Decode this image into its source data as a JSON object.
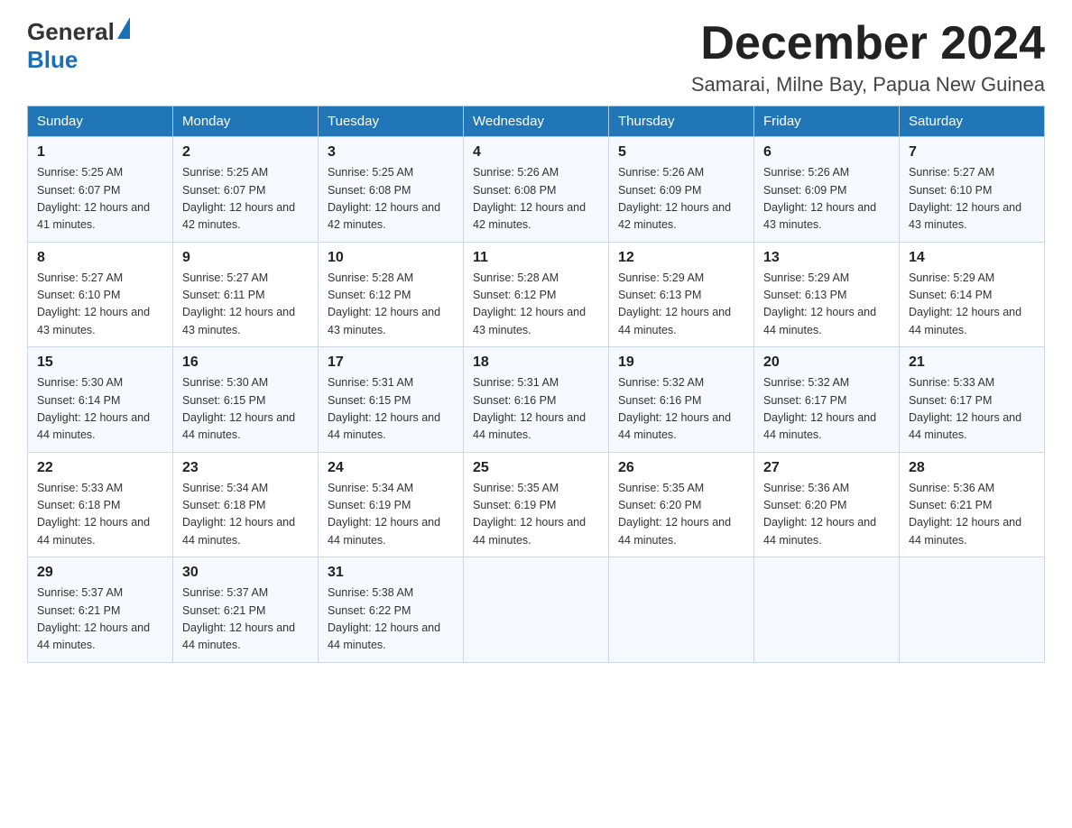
{
  "header": {
    "logo_general": "General",
    "logo_blue": "Blue",
    "month_title": "December 2024",
    "location": "Samarai, Milne Bay, Papua New Guinea"
  },
  "weekdays": [
    "Sunday",
    "Monday",
    "Tuesday",
    "Wednesday",
    "Thursday",
    "Friday",
    "Saturday"
  ],
  "weeks": [
    [
      {
        "day": "1",
        "sunrise": "5:25 AM",
        "sunset": "6:07 PM",
        "daylight": "12 hours and 41 minutes."
      },
      {
        "day": "2",
        "sunrise": "5:25 AM",
        "sunset": "6:07 PM",
        "daylight": "12 hours and 42 minutes."
      },
      {
        "day": "3",
        "sunrise": "5:25 AM",
        "sunset": "6:08 PM",
        "daylight": "12 hours and 42 minutes."
      },
      {
        "day": "4",
        "sunrise": "5:26 AM",
        "sunset": "6:08 PM",
        "daylight": "12 hours and 42 minutes."
      },
      {
        "day": "5",
        "sunrise": "5:26 AM",
        "sunset": "6:09 PM",
        "daylight": "12 hours and 42 minutes."
      },
      {
        "day": "6",
        "sunrise": "5:26 AM",
        "sunset": "6:09 PM",
        "daylight": "12 hours and 43 minutes."
      },
      {
        "day": "7",
        "sunrise": "5:27 AM",
        "sunset": "6:10 PM",
        "daylight": "12 hours and 43 minutes."
      }
    ],
    [
      {
        "day": "8",
        "sunrise": "5:27 AM",
        "sunset": "6:10 PM",
        "daylight": "12 hours and 43 minutes."
      },
      {
        "day": "9",
        "sunrise": "5:27 AM",
        "sunset": "6:11 PM",
        "daylight": "12 hours and 43 minutes."
      },
      {
        "day": "10",
        "sunrise": "5:28 AM",
        "sunset": "6:12 PM",
        "daylight": "12 hours and 43 minutes."
      },
      {
        "day": "11",
        "sunrise": "5:28 AM",
        "sunset": "6:12 PM",
        "daylight": "12 hours and 43 minutes."
      },
      {
        "day": "12",
        "sunrise": "5:29 AM",
        "sunset": "6:13 PM",
        "daylight": "12 hours and 44 minutes."
      },
      {
        "day": "13",
        "sunrise": "5:29 AM",
        "sunset": "6:13 PM",
        "daylight": "12 hours and 44 minutes."
      },
      {
        "day": "14",
        "sunrise": "5:29 AM",
        "sunset": "6:14 PM",
        "daylight": "12 hours and 44 minutes."
      }
    ],
    [
      {
        "day": "15",
        "sunrise": "5:30 AM",
        "sunset": "6:14 PM",
        "daylight": "12 hours and 44 minutes."
      },
      {
        "day": "16",
        "sunrise": "5:30 AM",
        "sunset": "6:15 PM",
        "daylight": "12 hours and 44 minutes."
      },
      {
        "day": "17",
        "sunrise": "5:31 AM",
        "sunset": "6:15 PM",
        "daylight": "12 hours and 44 minutes."
      },
      {
        "day": "18",
        "sunrise": "5:31 AM",
        "sunset": "6:16 PM",
        "daylight": "12 hours and 44 minutes."
      },
      {
        "day": "19",
        "sunrise": "5:32 AM",
        "sunset": "6:16 PM",
        "daylight": "12 hours and 44 minutes."
      },
      {
        "day": "20",
        "sunrise": "5:32 AM",
        "sunset": "6:17 PM",
        "daylight": "12 hours and 44 minutes."
      },
      {
        "day": "21",
        "sunrise": "5:33 AM",
        "sunset": "6:17 PM",
        "daylight": "12 hours and 44 minutes."
      }
    ],
    [
      {
        "day": "22",
        "sunrise": "5:33 AM",
        "sunset": "6:18 PM",
        "daylight": "12 hours and 44 minutes."
      },
      {
        "day": "23",
        "sunrise": "5:34 AM",
        "sunset": "6:18 PM",
        "daylight": "12 hours and 44 minutes."
      },
      {
        "day": "24",
        "sunrise": "5:34 AM",
        "sunset": "6:19 PM",
        "daylight": "12 hours and 44 minutes."
      },
      {
        "day": "25",
        "sunrise": "5:35 AM",
        "sunset": "6:19 PM",
        "daylight": "12 hours and 44 minutes."
      },
      {
        "day": "26",
        "sunrise": "5:35 AM",
        "sunset": "6:20 PM",
        "daylight": "12 hours and 44 minutes."
      },
      {
        "day": "27",
        "sunrise": "5:36 AM",
        "sunset": "6:20 PM",
        "daylight": "12 hours and 44 minutes."
      },
      {
        "day": "28",
        "sunrise": "5:36 AM",
        "sunset": "6:21 PM",
        "daylight": "12 hours and 44 minutes."
      }
    ],
    [
      {
        "day": "29",
        "sunrise": "5:37 AM",
        "sunset": "6:21 PM",
        "daylight": "12 hours and 44 minutes."
      },
      {
        "day": "30",
        "sunrise": "5:37 AM",
        "sunset": "6:21 PM",
        "daylight": "12 hours and 44 minutes."
      },
      {
        "day": "31",
        "sunrise": "5:38 AM",
        "sunset": "6:22 PM",
        "daylight": "12 hours and 44 minutes."
      },
      null,
      null,
      null,
      null
    ]
  ],
  "labels": {
    "sunrise": "Sunrise:",
    "sunset": "Sunset:",
    "daylight": "Daylight:"
  }
}
